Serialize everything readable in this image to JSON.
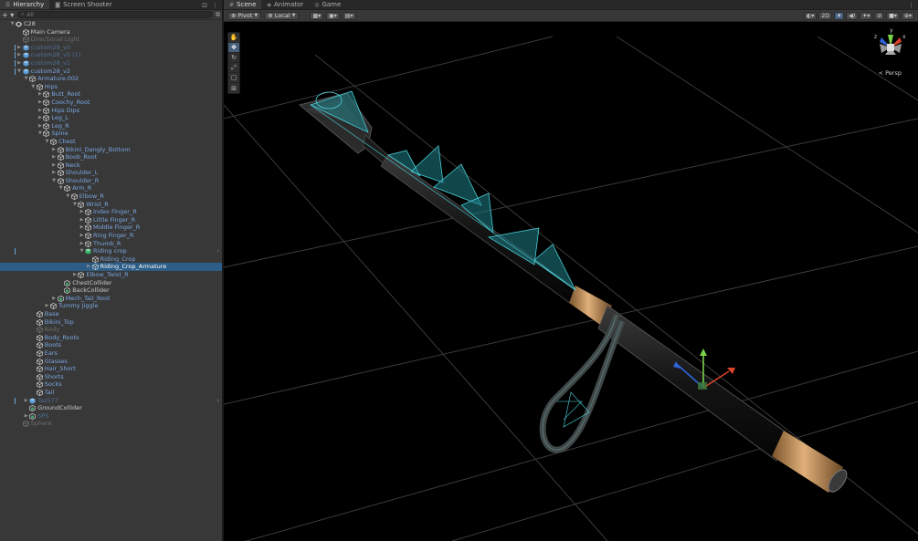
{
  "hierarchy": {
    "tabs": [
      {
        "label": "Hierarchy",
        "icon": "list-icon"
      },
      {
        "label": "Screen Shooter",
        "icon": "camera-icon"
      }
    ],
    "search_placeholder": "All",
    "add_label": "+ ▾",
    "rows": [
      {
        "label": "C28",
        "depth": 0,
        "arrow": "open",
        "icon": "scene",
        "color": "default",
        "scene": true
      },
      {
        "label": "Main Camera",
        "depth": 1,
        "arrow": "none",
        "icon": "cube",
        "color": "default"
      },
      {
        "label": "Directional Light",
        "depth": 1,
        "arrow": "none",
        "icon": "cube",
        "color": "dim"
      },
      {
        "label": "custom28_v0",
        "depth": 1,
        "arrow": "closed",
        "icon": "prefab",
        "color": "dimprefab",
        "bar": true
      },
      {
        "label": "custom28_v0 (1)",
        "depth": 1,
        "arrow": "closed",
        "icon": "prefab",
        "color": "dimprefab",
        "bar": true
      },
      {
        "label": "custom28_v1",
        "depth": 1,
        "arrow": "closed",
        "icon": "prefab",
        "color": "dimprefab",
        "bar": true
      },
      {
        "label": "custom28_v2",
        "depth": 1,
        "arrow": "open",
        "icon": "prefab",
        "color": "prefab",
        "bar": true
      },
      {
        "label": "Armature.002",
        "depth": 2,
        "arrow": "open",
        "icon": "cube",
        "color": "prefab"
      },
      {
        "label": "Hips",
        "depth": 3,
        "arrow": "open",
        "icon": "cube",
        "color": "prefab"
      },
      {
        "label": "Butt_Root",
        "depth": 4,
        "arrow": "closed",
        "icon": "cube",
        "color": "prefab"
      },
      {
        "label": "Coochy_Root",
        "depth": 4,
        "arrow": "closed",
        "icon": "cube",
        "color": "prefab"
      },
      {
        "label": "Hips Dips",
        "depth": 4,
        "arrow": "closed",
        "icon": "cube",
        "color": "prefab"
      },
      {
        "label": "Leg_L",
        "depth": 4,
        "arrow": "closed",
        "icon": "cube",
        "color": "prefab"
      },
      {
        "label": "Leg_R",
        "depth": 4,
        "arrow": "closed",
        "icon": "cube",
        "color": "prefab"
      },
      {
        "label": "Spine",
        "depth": 4,
        "arrow": "open",
        "icon": "cube",
        "color": "prefab"
      },
      {
        "label": "Chest",
        "depth": 5,
        "arrow": "open",
        "icon": "cube",
        "color": "prefab"
      },
      {
        "label": "Bikini_Dangly_Bottom",
        "depth": 6,
        "arrow": "closed",
        "icon": "cube",
        "color": "prefab"
      },
      {
        "label": "Boob_Root",
        "depth": 6,
        "arrow": "closed",
        "icon": "cube",
        "color": "prefab"
      },
      {
        "label": "Neck",
        "depth": 6,
        "arrow": "closed",
        "icon": "cube",
        "color": "prefab"
      },
      {
        "label": "Shoulder_L",
        "depth": 6,
        "arrow": "closed",
        "icon": "cube",
        "color": "prefab"
      },
      {
        "label": "Shoulder_R",
        "depth": 6,
        "arrow": "open",
        "icon": "cube",
        "color": "prefab"
      },
      {
        "label": "Arm_R",
        "depth": 7,
        "arrow": "open",
        "icon": "cube",
        "color": "prefab"
      },
      {
        "label": "Elbow_R",
        "depth": 8,
        "arrow": "open",
        "icon": "cube",
        "color": "prefab"
      },
      {
        "label": "Wrist_R",
        "depth": 9,
        "arrow": "open",
        "icon": "cube",
        "color": "prefab"
      },
      {
        "label": "Index Finger_R",
        "depth": 10,
        "arrow": "closed",
        "icon": "cube",
        "color": "prefab"
      },
      {
        "label": "Little Finger_R",
        "depth": 10,
        "arrow": "closed",
        "icon": "cube",
        "color": "prefab"
      },
      {
        "label": "Middle Finger_R",
        "depth": 10,
        "arrow": "closed",
        "icon": "cube",
        "color": "prefab"
      },
      {
        "label": "Ring Finger_R",
        "depth": 10,
        "arrow": "closed",
        "icon": "cube",
        "color": "prefab"
      },
      {
        "label": "Thumb_R",
        "depth": 10,
        "arrow": "closed",
        "icon": "cube",
        "color": "prefab"
      },
      {
        "label": "Riding crop",
        "depth": 10,
        "arrow": "open",
        "icon": "prefab-green",
        "color": "prefab",
        "bar": true,
        "more": true
      },
      {
        "label": "Riding_Crop",
        "depth": 11,
        "arrow": "none",
        "icon": "cube",
        "color": "prefab"
      },
      {
        "label": "Riding_Crop_Armature",
        "depth": 11,
        "arrow": "closed",
        "icon": "cube",
        "color": "default",
        "selected": true
      },
      {
        "label": "Elbow_Twist_R",
        "depth": 9,
        "arrow": "closed",
        "icon": "cube",
        "color": "prefab"
      },
      {
        "label": "ChestCollider",
        "depth": 7,
        "arrow": "none",
        "icon": "green",
        "color": "default"
      },
      {
        "label": "BackCollider",
        "depth": 7,
        "arrow": "none",
        "icon": "green",
        "color": "default"
      },
      {
        "label": "Mech_Tail_Root",
        "depth": 6,
        "arrow": "closed",
        "icon": "green",
        "color": "prefab"
      },
      {
        "label": "Tummy Jiggle",
        "depth": 5,
        "arrow": "closed",
        "icon": "cube",
        "color": "prefab"
      },
      {
        "label": "Base",
        "depth": 3,
        "arrow": "none",
        "icon": "cube",
        "color": "prefab"
      },
      {
        "label": "Bikini_Top",
        "depth": 3,
        "arrow": "none",
        "icon": "cube",
        "color": "prefab"
      },
      {
        "label": "Body",
        "depth": 3,
        "arrow": "none",
        "icon": "cube",
        "color": "dim"
      },
      {
        "label": "Body_Roots",
        "depth": 3,
        "arrow": "none",
        "icon": "cube",
        "color": "prefab"
      },
      {
        "label": "Boots",
        "depth": 3,
        "arrow": "none",
        "icon": "cube",
        "color": "prefab"
      },
      {
        "label": "Ears",
        "depth": 3,
        "arrow": "none",
        "icon": "cube",
        "color": "prefab"
      },
      {
        "label": "Glasses",
        "depth": 3,
        "arrow": "none",
        "icon": "cube",
        "color": "prefab"
      },
      {
        "label": "Hair_Short",
        "depth": 3,
        "arrow": "none",
        "icon": "cube",
        "color": "prefab"
      },
      {
        "label": "Shorts",
        "depth": 3,
        "arrow": "none",
        "icon": "cube",
        "color": "prefab"
      },
      {
        "label": "Socks",
        "depth": 3,
        "arrow": "none",
        "icon": "cube",
        "color": "prefab"
      },
      {
        "label": "Tail",
        "depth": 3,
        "arrow": "none",
        "icon": "cube",
        "color": "prefab"
      },
      {
        "label": "Taz577",
        "depth": 2,
        "arrow": "closed",
        "icon": "prefab",
        "color": "dimprefab",
        "bar": true,
        "more": true
      },
      {
        "label": "GroundCollider",
        "depth": 2,
        "arrow": "none",
        "icon": "green",
        "color": "default"
      },
      {
        "label": "SPS",
        "depth": 2,
        "arrow": "closed",
        "icon": "green",
        "color": "dimprefab"
      },
      {
        "label": "Sphere",
        "depth": 1,
        "arrow": "none",
        "icon": "cube",
        "color": "dim"
      }
    ]
  },
  "scene": {
    "tabs": [
      {
        "label": "Scene",
        "icon": "scene-grid-icon",
        "active": true
      },
      {
        "label": "Animator",
        "icon": "animator-icon",
        "active": false
      },
      {
        "label": "Game",
        "icon": "gamepad-icon",
        "active": false
      }
    ],
    "pivot_label": "Pivot",
    "local_label": "Local",
    "btn_2d": "2D",
    "persp_label": "< Persp",
    "axis_y": "y",
    "axis_x": "x",
    "axis_z": "z"
  },
  "colors": {
    "accent_selection": "#2c5d87",
    "prefab_text": "#7aa6e0",
    "bone_cyan": "#4ad0d8",
    "brass": "#b8864a"
  }
}
